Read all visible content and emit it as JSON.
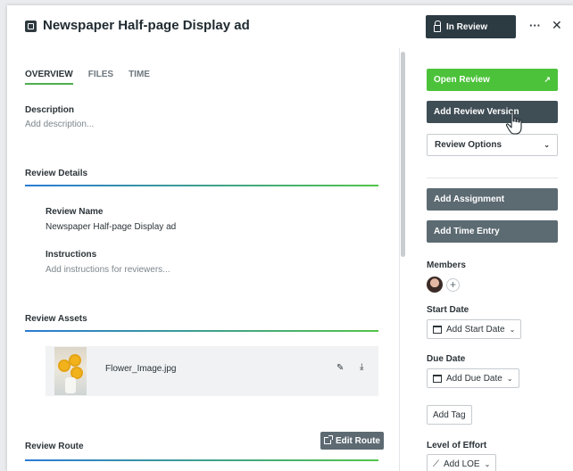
{
  "header": {
    "title": "Newspaper Half-page Display ad",
    "status_label": "In Review",
    "more_label": "···",
    "close_label": "✕"
  },
  "tabs": [
    {
      "label": "OVERVIEW",
      "active": true
    },
    {
      "label": "FILES",
      "active": false
    },
    {
      "label": "TIME",
      "active": false
    }
  ],
  "overview": {
    "description_label": "Description",
    "description_placeholder": "Add description..."
  },
  "review_details": {
    "title": "Review Details",
    "review_name_label": "Review Name",
    "review_name_value": "Newspaper Half-page Display ad",
    "instructions_label": "Instructions",
    "instructions_placeholder": "Add instructions for reviewers..."
  },
  "review_assets": {
    "title": "Review Assets",
    "items": [
      {
        "name": "Flower_Image.jpg",
        "edit_icon": "✎",
        "download_icon": "⤓"
      }
    ]
  },
  "review_route": {
    "title": "Review Route",
    "edit_label": "Edit Route"
  },
  "sidebar": {
    "open_review": "Open Review",
    "open_review_icon": "↗",
    "add_review_version": "Add Review Version",
    "review_options": "Review Options",
    "add_assignment": "Add Assignment",
    "add_time_entry": "Add Time Entry",
    "members_label": "Members",
    "add_member": "+",
    "start_date_label": "Start Date",
    "start_date_button": "Add Start Date",
    "due_date_label": "Due Date",
    "due_date_button": "Add Due Date",
    "add_tag": "Add Tag",
    "loe_label": "Level of Effort",
    "loe_button": "Add LOE"
  },
  "colors": {
    "accent_green": "#4cc23a",
    "dark_button": "#3f4d55",
    "slate_button": "#5c6a72",
    "status_button": "#2c3a42",
    "section_line_start": "#2a7bd6",
    "section_line_end": "#52c44a"
  }
}
